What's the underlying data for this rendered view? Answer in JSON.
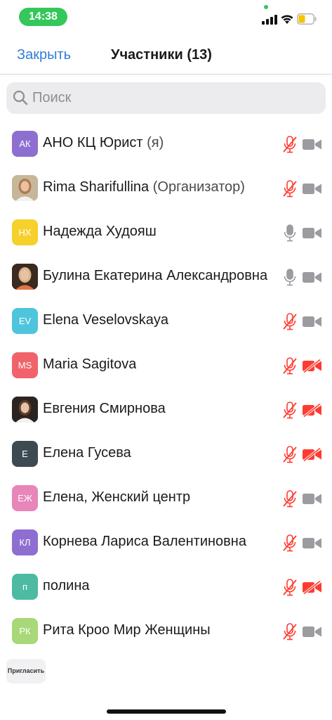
{
  "status_bar": {
    "time": "14:38",
    "icons": [
      "cellular-signal-icon",
      "wifi-icon",
      "battery-icon"
    ],
    "battery_level": 0.45,
    "accent_color": "#34c759"
  },
  "nav": {
    "close_label": "Закрыть",
    "title": "Участники (13)"
  },
  "search": {
    "placeholder": "Поиск",
    "value": ""
  },
  "colors": {
    "link": "#2f7dd6",
    "muted_red": "#ff3b30",
    "icon_gray": "#9b9ba0"
  },
  "participants": [
    {
      "name": "АНО КЦ Юрист",
      "role": "(я)",
      "avatar_text": "АК",
      "avatar_color": "#8e6fd1",
      "mic": "muted",
      "video": "on"
    },
    {
      "name": "Rima Sharifullina",
      "role": "(Организатор)",
      "avatar_text": "",
      "avatar_color": "#c7b79a",
      "photo": true,
      "mic": "muted",
      "video": "on"
    },
    {
      "name": "Надежда Худояш",
      "role": "",
      "avatar_text": "НХ",
      "avatar_color": "#f6d12b",
      "mic": "on",
      "video": "on"
    },
    {
      "name": "Булина Екатерина Александровна",
      "role": "",
      "avatar_text": "",
      "avatar_color": "#3b2a20",
      "photo": true,
      "mic": "on",
      "video": "on"
    },
    {
      "name": "Elena Veselovskaya",
      "role": "",
      "avatar_text": "EV",
      "avatar_color": "#4fc5dd",
      "mic": "muted",
      "video": "on"
    },
    {
      "name": "Maria Sagitova",
      "role": "",
      "avatar_text": "MS",
      "avatar_color": "#f1636a",
      "mic": "muted",
      "video": "off"
    },
    {
      "name": "Евгения Смирнова",
      "role": "",
      "avatar_text": "",
      "avatar_color": "#2b2420",
      "photo": true,
      "mic": "muted",
      "video": "off"
    },
    {
      "name": "Елена Гусева",
      "role": "",
      "avatar_text": "Е",
      "avatar_color": "#3e4a52",
      "mic": "muted",
      "video": "off"
    },
    {
      "name": "Елена, Женский центр",
      "role": "",
      "avatar_text": "ЕЖ",
      "avatar_color": "#e885b9",
      "mic": "muted",
      "video": "on"
    },
    {
      "name": "Корнева Лариса Валентиновна",
      "role": "",
      "avatar_text": "КЛ",
      "avatar_color": "#8e6fd1",
      "mic": "muted",
      "video": "on"
    },
    {
      "name": "полина",
      "role": "",
      "avatar_text": "п",
      "avatar_color": "#4dbba2",
      "mic": "muted",
      "video": "off"
    },
    {
      "name": "Рита Кроо Мир Женщины",
      "role": "",
      "avatar_text": "РК",
      "avatar_color": "#a8d878",
      "mic": "muted",
      "video": "on"
    }
  ],
  "footer": {
    "invite_label": "Пригласить"
  }
}
